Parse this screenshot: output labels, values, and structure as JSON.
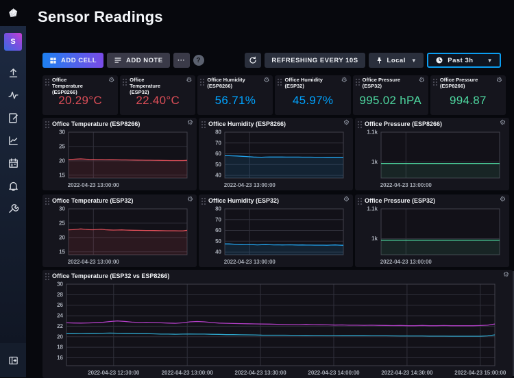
{
  "header": {
    "title": "Sensor Readings"
  },
  "sidebar": {
    "avatar_letter": "S",
    "icons": [
      "influxdb-logo",
      "upload-icon",
      "data-explorer-icon",
      "notebooks-icon",
      "dashboards-icon",
      "tasks-calendar-icon",
      "alerts-bell-icon",
      "settings-wrench-icon",
      "expand-sidebar-icon"
    ]
  },
  "toolbar": {
    "add_cell": "ADD CELL",
    "add_note": "ADD NOTE",
    "more": "···",
    "help": "?",
    "refresh_label": "REFRESHING EVERY 10S",
    "timezone": "Local",
    "time_range": "Past 3h"
  },
  "colors": {
    "accent": "#00A3FF",
    "temperature": "#DC4E58",
    "humidity": "#00A3FF",
    "pressure": "#4ED8A0",
    "big_esp32": "#B23FC6",
    "big_esp8266": "#2FA8CE"
  },
  "stats": [
    {
      "title": "Office Temperature (ESP8266)",
      "value": "20.29°C",
      "color": "#DC4E58"
    },
    {
      "title": "Office Temperature (ESP32)",
      "value": "22.40°C",
      "color": "#DC4E58"
    },
    {
      "title": "Office Humidity (ESP8266)",
      "value": "56.71%",
      "color": "#00A3FF"
    },
    {
      "title": "Office Humidity (ESP32)",
      "value": "45.97%",
      "color": "#00A3FF"
    },
    {
      "title": "Office Pressure (ESP32)",
      "value": "995.02 hPA",
      "color": "#4ED8A0"
    },
    {
      "title": "Office Pressure (ESP8266)",
      "value": "994.87",
      "color": "#4ED8A0"
    }
  ],
  "chart_data": [
    {
      "type": "line",
      "title": "Office Temperature (ESP8266)",
      "ylim": [
        14,
        30
      ],
      "yticks": [
        15,
        20,
        25,
        30
      ],
      "xticks": [
        {
          "frac": 0.21,
          "label": "2022-04-23 13:00:00"
        }
      ],
      "margins": {
        "l": 38,
        "r": 14,
        "t": 4,
        "b": 18
      },
      "series": [
        {
          "name": "Office Temperature ESP8266",
          "color": "#DC4E58",
          "fill": "rgba(220,78,88,0.13)",
          "values": [
            20.5,
            20.55,
            20.62,
            20.68,
            20.6,
            20.52,
            20.5,
            20.48,
            20.46,
            20.42,
            20.4,
            20.38,
            20.36,
            20.33,
            20.32,
            20.3,
            20.28,
            20.26,
            20.24,
            20.22,
            20.2,
            20.18,
            20.16,
            20.14,
            20.12,
            20.1,
            20.1,
            20.08,
            20.1,
            20.16
          ]
        }
      ]
    },
    {
      "type": "line",
      "title": "Office Humidity (ESP8266)",
      "ylim": [
        37.5,
        80
      ],
      "yticks": [
        40,
        50,
        60,
        70,
        80
      ],
      "xticks": [
        {
          "frac": 0.21,
          "label": "2022-04-23 13:00:00"
        }
      ],
      "margins": {
        "l": 38,
        "r": 14,
        "t": 4,
        "b": 18
      },
      "series": [
        {
          "name": "Office Humidity ESP8266",
          "color": "#22A5F0",
          "fill": "rgba(34,165,240,0.13)",
          "values": [
            58.2,
            58.15,
            58.05,
            57.9,
            57.7,
            57.45,
            57.2,
            57.0,
            56.85,
            56.8,
            56.9,
            57.0,
            57.0,
            56.98,
            56.95,
            56.92,
            56.9,
            56.9,
            56.88,
            56.85,
            56.84,
            56.82,
            56.8,
            56.78,
            56.76,
            56.74,
            56.72,
            56.7,
            56.7,
            56.71
          ]
        }
      ]
    },
    {
      "type": "line",
      "title": "Office Pressure (ESP8266)",
      "ylim": [
        946,
        1100
      ],
      "yticks": [
        1000,
        1100
      ],
      "ytick_labels": [
        "1k",
        "1.1k"
      ],
      "xticks": [
        {
          "frac": 0.21,
          "label": "2022-04-23 13:00:00"
        }
      ],
      "margins": {
        "l": 38,
        "r": 14,
        "t": 4,
        "b": 18
      },
      "series": [
        {
          "name": "Office Pressure ESP8266",
          "color": "#4ED8A0",
          "fill": "rgba(78,216,160,0.10)",
          "values": [
            994.9,
            994.92,
            994.9,
            994.88,
            994.9,
            994.91,
            994.9,
            994.89,
            994.9,
            994.91,
            994.92,
            994.9,
            994.88,
            994.87,
            994.89,
            994.9,
            994.89,
            994.88,
            994.9,
            994.89,
            994.88,
            994.87,
            994.87,
            994.88,
            994.89,
            994.88,
            994.87,
            994.86,
            994.87,
            994.87
          ]
        }
      ]
    },
    {
      "type": "line",
      "title": "Office Temperature (ESP32)",
      "ylim": [
        14,
        30
      ],
      "yticks": [
        15,
        20,
        25,
        30
      ],
      "xticks": [
        {
          "frac": 0.21,
          "label": "2022-04-23 13:00:00"
        }
      ],
      "margins": {
        "l": 38,
        "r": 14,
        "t": 4,
        "b": 18
      },
      "series": [
        {
          "name": "Office Temperature ESP32",
          "color": "#DC4E58",
          "fill": "rgba(220,78,88,0.13)",
          "values": [
            22.7,
            22.75,
            22.85,
            23.0,
            22.85,
            22.76,
            22.72,
            22.8,
            22.9,
            22.72,
            22.65,
            22.6,
            22.62,
            22.68,
            22.6,
            22.55,
            22.52,
            22.5,
            22.48,
            22.46,
            22.45,
            22.42,
            22.4,
            22.38,
            22.37,
            22.36,
            22.35,
            22.34,
            22.33,
            22.5
          ]
        }
      ]
    },
    {
      "type": "line",
      "title": "Office Humidity (ESP32)",
      "ylim": [
        37.5,
        80
      ],
      "yticks": [
        40,
        50,
        60,
        70,
        80
      ],
      "xticks": [
        {
          "frac": 0.21,
          "label": "2022-04-23 13:00:00"
        }
      ],
      "margins": {
        "l": 38,
        "r": 14,
        "t": 4,
        "b": 18
      },
      "series": [
        {
          "name": "Office Humidity ESP32",
          "color": "#22A5F0",
          "fill": "rgba(34,165,240,0.13)",
          "values": [
            47.6,
            47.5,
            47.35,
            47.1,
            46.9,
            46.75,
            46.95,
            46.85,
            46.65,
            46.8,
            46.9,
            46.75,
            46.65,
            46.7,
            46.6,
            46.65,
            46.7,
            46.6,
            46.5,
            46.55,
            46.45,
            46.45,
            46.4,
            46.35,
            46.35,
            46.3,
            46.45,
            46.55,
            46.35,
            46.25
          ]
        }
      ]
    },
    {
      "type": "line",
      "title": "Office Pressure (ESP32)",
      "ylim": [
        946,
        1100
      ],
      "yticks": [
        1000,
        1100
      ],
      "ytick_labels": [
        "1k",
        "1.1k"
      ],
      "xticks": [
        {
          "frac": 0.21,
          "label": "2022-04-23 13:00:00"
        }
      ],
      "margins": {
        "l": 38,
        "r": 14,
        "t": 4,
        "b": 18
      },
      "series": [
        {
          "name": "Office Pressure ESP32",
          "color": "#4ED8A0",
          "fill": "rgba(78,216,160,0.10)",
          "values": [
            995.0,
            995.02,
            995.0,
            994.98,
            995.0,
            995.01,
            995.0,
            994.99,
            995.0,
            995.01,
            995.02,
            995.0,
            994.99,
            995.0,
            995.01,
            995.0,
            994.99,
            994.98,
            995.0,
            995.0,
            994.99,
            995.0,
            995.01,
            995.0,
            994.99,
            995.0,
            995.01,
            995.02,
            995.01,
            995.02
          ]
        }
      ]
    },
    {
      "type": "line",
      "title": "Office Temperature (ESP32 vs ESP8266)",
      "ylim": [
        14.5,
        30
      ],
      "yticks": [
        16,
        18,
        20,
        22,
        24,
        26,
        28,
        30
      ],
      "xticks": [
        {
          "frac": 0.11,
          "label": "2022-04-23 12:30:00"
        },
        {
          "frac": 0.282,
          "label": "2022-04-23 13:00:00"
        },
        {
          "frac": 0.453,
          "label": "2022-04-23 13:30:00"
        },
        {
          "frac": 0.624,
          "label": "2022-04-23 14:00:00"
        },
        {
          "frac": 0.795,
          "label": "2022-04-23 14:30:00"
        },
        {
          "frac": 0.966,
          "label": "2022-04-23 15:00:00"
        }
      ],
      "margins": {
        "l": 35,
        "r": 26,
        "t": 4,
        "b": 18
      },
      "series": [
        {
          "name": "Office Temperature ESP32",
          "color": "#B23FC6",
          "fill": null,
          "values": [
            22.65,
            22.62,
            22.6,
            22.63,
            22.68,
            22.75,
            22.9,
            23.0,
            22.92,
            22.78,
            22.72,
            22.76,
            22.72,
            22.66,
            22.6,
            22.56,
            22.66,
            22.84,
            22.9,
            22.84,
            22.7,
            22.6,
            22.56,
            22.52,
            22.5,
            22.47,
            22.45,
            22.42,
            22.4,
            22.37,
            22.33,
            22.32,
            22.3,
            22.34,
            22.3,
            22.27,
            22.26,
            22.22,
            22.25,
            22.2,
            22.2,
            22.17,
            22.2,
            22.16,
            22.15,
            22.12,
            22.15,
            22.1,
            22.1,
            22.14,
            22.1,
            22.1,
            22.13,
            22.1,
            22.1,
            22.1,
            22.1,
            22.13,
            22.2,
            22.42
          ]
        },
        {
          "name": "Office Temperature ESP8266",
          "color": "#2FA8CE",
          "fill": null,
          "values": [
            20.6,
            20.6,
            20.62,
            20.65,
            20.66,
            20.68,
            20.7,
            20.68,
            20.66,
            20.65,
            20.6,
            20.6,
            20.56,
            20.5,
            20.5,
            20.48,
            20.5,
            20.52,
            20.5,
            20.5,
            20.46,
            20.45,
            20.4,
            20.4,
            20.38,
            20.36,
            20.35,
            20.3,
            20.3,
            20.3,
            20.3,
            20.28,
            20.28,
            20.26,
            20.25,
            20.25,
            20.22,
            20.22,
            20.2,
            20.2,
            20.2,
            20.2,
            20.18,
            20.18,
            20.18,
            20.16,
            20.15,
            20.15,
            20.15,
            20.15,
            20.12,
            20.12,
            20.12,
            20.1,
            20.1,
            20.1,
            20.1,
            20.1,
            20.16,
            20.36
          ]
        }
      ]
    }
  ]
}
